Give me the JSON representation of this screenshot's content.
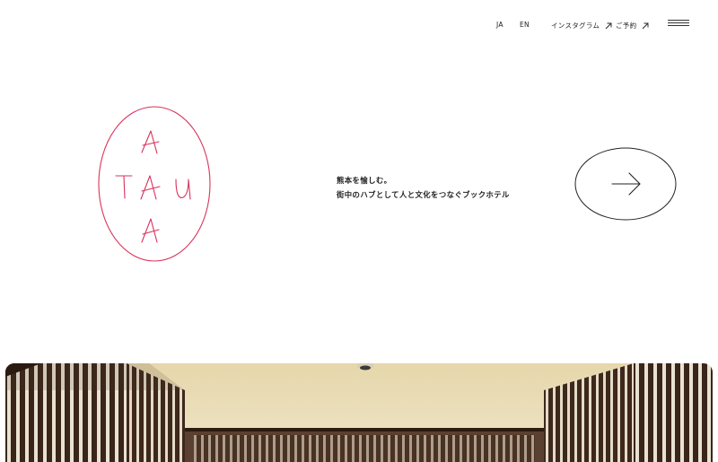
{
  "nav": {
    "lang_ja": "JA",
    "lang_en": "EN",
    "instagram": "インスタグラム",
    "reserve": "ご予約",
    "external_icon": "arrow-up-right-icon",
    "menu_icon": "hamburger-menu-icon"
  },
  "logo": {
    "letters": [
      "A",
      "T",
      "A",
      "U",
      "A"
    ]
  },
  "tagline": {
    "line1": "熊本を愉しむ。",
    "line2": "街中のハブとして人と文化をつなぐブックホテル"
  },
  "hero": {
    "image": "hotel-interior-photo"
  },
  "colors": {
    "accent": "#d9325b",
    "text": "#222222",
    "wood": "#4a3426",
    "ceiling": "#e9dfbf"
  }
}
